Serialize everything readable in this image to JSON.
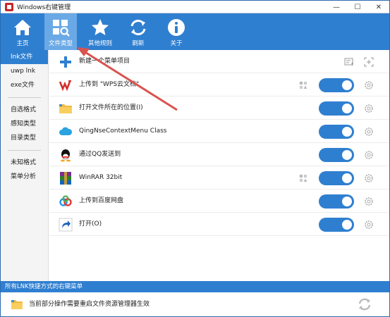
{
  "window": {
    "title": "Windows右键管理",
    "min": "—",
    "max": "☐",
    "close": "✕"
  },
  "toolbar": {
    "items": [
      {
        "label": "主页",
        "icon": "home-icon"
      },
      {
        "label": "文件类型",
        "icon": "grid-search-icon"
      },
      {
        "label": "其他规则",
        "icon": "star-icon"
      },
      {
        "label": "刷新",
        "icon": "refresh-icon"
      },
      {
        "label": "关于",
        "icon": "info-icon"
      }
    ],
    "active_index": 1
  },
  "sidebar": {
    "items": [
      {
        "label": "lnk文件",
        "active": true
      },
      {
        "label": "uwp lnk"
      },
      {
        "label": "exe文件"
      },
      {
        "label": "自选格式"
      },
      {
        "label": "感知类型"
      },
      {
        "label": "目录类型"
      },
      {
        "label": "未知格式"
      },
      {
        "label": "菜单分析"
      }
    ]
  },
  "main": {
    "new_item_label": "新建一个菜单项目",
    "rows": [
      {
        "label": "上传到 \"WPS云文档\"",
        "icon": "wps-icon",
        "enabled": true,
        "has_shapes": true
      },
      {
        "label": "打开文件所在的位置(I)",
        "icon": "folder-icon",
        "enabled": true
      },
      {
        "label": "QingNseContextMenu Class",
        "icon": "cloud-icon",
        "enabled": true
      },
      {
        "label": "通过QQ发送到",
        "icon": "qq-icon",
        "enabled": true
      },
      {
        "label": "WinRAR 32bit",
        "icon": "winrar-icon",
        "enabled": true,
        "has_shapes": true
      },
      {
        "label": "上传到百度网盘",
        "icon": "baidu-netdisk-icon",
        "enabled": true
      },
      {
        "label": "打开(O)",
        "icon": "shortcut-arrow-icon",
        "enabled": true
      }
    ]
  },
  "status_bar": {
    "text": "所有LNK快捷方式的右键菜单"
  },
  "notice": {
    "text": "当前部分操作需要重启文件资源管理器生效"
  },
  "colors": {
    "accent": "#2f7fd0",
    "active_tool": "#6aa9e6",
    "arrow": "#d9534f"
  }
}
